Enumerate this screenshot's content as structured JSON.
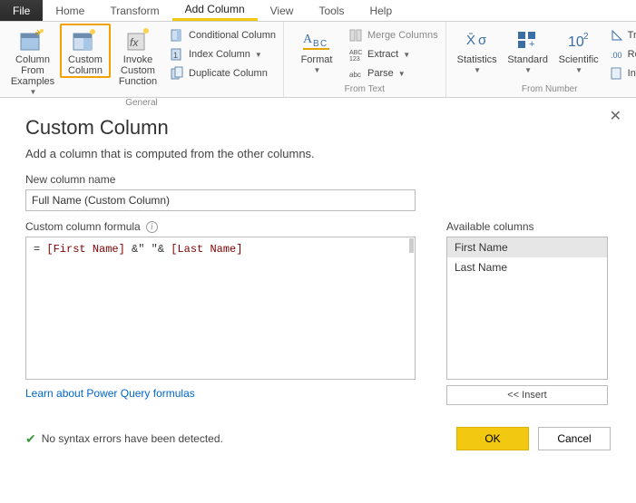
{
  "tabs": {
    "file": "File",
    "home": "Home",
    "transform": "Transform",
    "add_column": "Add Column",
    "view": "View",
    "tools": "Tools",
    "help": "Help"
  },
  "ribbon": {
    "general": {
      "label": "General",
      "column_from_examples": "Column From Examples",
      "custom_column": "Custom Column",
      "invoke_custom_function": "Invoke Custom Function",
      "conditional_column": "Conditional Column",
      "index_column": "Index Column",
      "duplicate_column": "Duplicate Column"
    },
    "format_group": {
      "button": "Format",
      "merge": "Merge Columns",
      "extract": "Extract",
      "parse": "Parse",
      "label": "From Text"
    },
    "number_group": {
      "stats": "Statistics",
      "standard": "Standard",
      "scientific": "Scientific",
      "trig": "Trig",
      "round": "Rou",
      "info": "Info",
      "label": "From Number"
    }
  },
  "dialog": {
    "title": "Custom Column",
    "subtitle": "Add a column that is computed from the other columns.",
    "new_col_label": "New column name",
    "new_col_value": "Full Name (Custom Column)",
    "formula_label": "Custom column formula",
    "formula_text": "= [First Name] &\" \"& [Last Name]",
    "avail_label": "Available columns",
    "avail_items": [
      "First Name",
      "Last Name"
    ],
    "insert": "<< Insert",
    "learn": "Learn about Power Query formulas",
    "status": "No syntax errors have been detected.",
    "ok": "OK",
    "cancel": "Cancel"
  }
}
